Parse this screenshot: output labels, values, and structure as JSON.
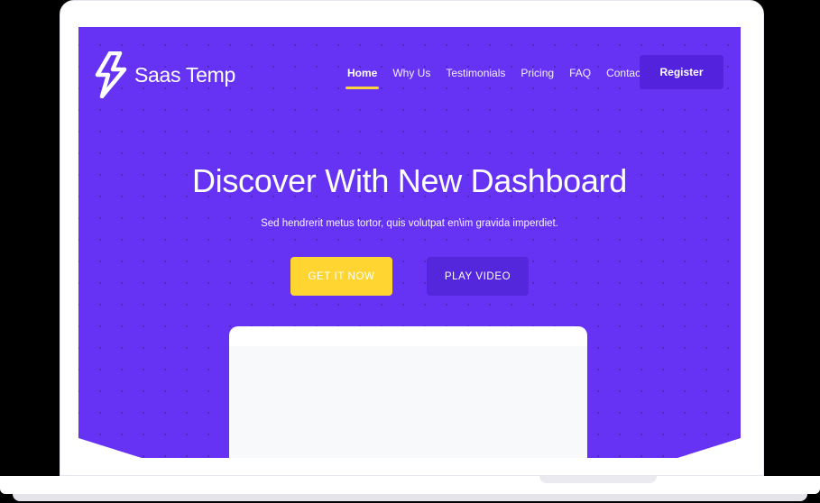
{
  "brand": {
    "name": "Saas Temp",
    "icon": "lightning-bolt-icon"
  },
  "nav": {
    "items": [
      {
        "label": "Home",
        "active": true
      },
      {
        "label": "Why Us",
        "active": false
      },
      {
        "label": "Testimonials",
        "active": false
      },
      {
        "label": "Pricing",
        "active": false
      },
      {
        "label": "FAQ",
        "active": false
      },
      {
        "label": "Contact Us",
        "active": false
      }
    ],
    "register_label": "Register"
  },
  "hero": {
    "title": "Discover With New Dashboard",
    "subtitle": "Sed hendrerit metus tortor, quis volutpat en\\im gravida imperdiet.",
    "primary_cta": "GET IT NOW",
    "secondary_cta": "PLAY VIDEO"
  },
  "colors": {
    "background": "#6633f5",
    "button_dark": "#5222dc",
    "accent_yellow": "#fed531",
    "text": "#ffffff"
  }
}
